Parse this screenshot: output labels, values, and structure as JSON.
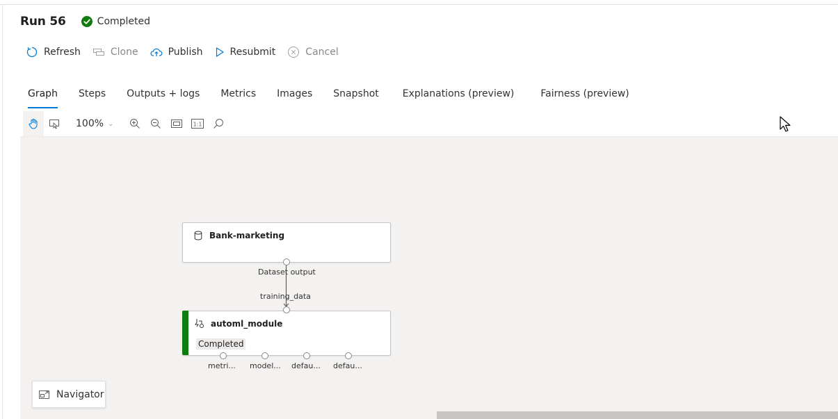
{
  "header": {
    "run_title": "Run 56",
    "status": "Completed",
    "status_color": "#107c10"
  },
  "toolbar": {
    "refresh": "Refresh",
    "clone": "Clone",
    "publish": "Publish",
    "resubmit": "Resubmit",
    "cancel": "Cancel"
  },
  "tabs": [
    {
      "label": "Graph",
      "active": true
    },
    {
      "label": "Steps"
    },
    {
      "label": "Outputs + logs"
    },
    {
      "label": "Metrics"
    },
    {
      "label": "Images"
    },
    {
      "label": "Snapshot"
    },
    {
      "label": "Explanations (preview)"
    },
    {
      "label": "Fairness (preview)"
    }
  ],
  "canvas_toolbar": {
    "zoom": "100%",
    "icons": [
      "pan-hand-icon",
      "select-icon",
      "zoom-in-icon",
      "zoom-out-icon",
      "fit-to-screen-icon",
      "actual-size-icon",
      "search-icon"
    ],
    "actual_size_label": "1:1"
  },
  "graph": {
    "dataset_node": {
      "name": "Bank-marketing",
      "output_label": "Dataset output"
    },
    "module_node": {
      "name": "automl_module",
      "input_label": "training_data",
      "status": "Completed",
      "status_color": "#107c10",
      "outputs": [
        "metri...",
        "model...",
        "defau...",
        "defau..."
      ]
    }
  },
  "navigator": {
    "label": "Navigator"
  },
  "colors": {
    "accent": "#0078d4"
  }
}
